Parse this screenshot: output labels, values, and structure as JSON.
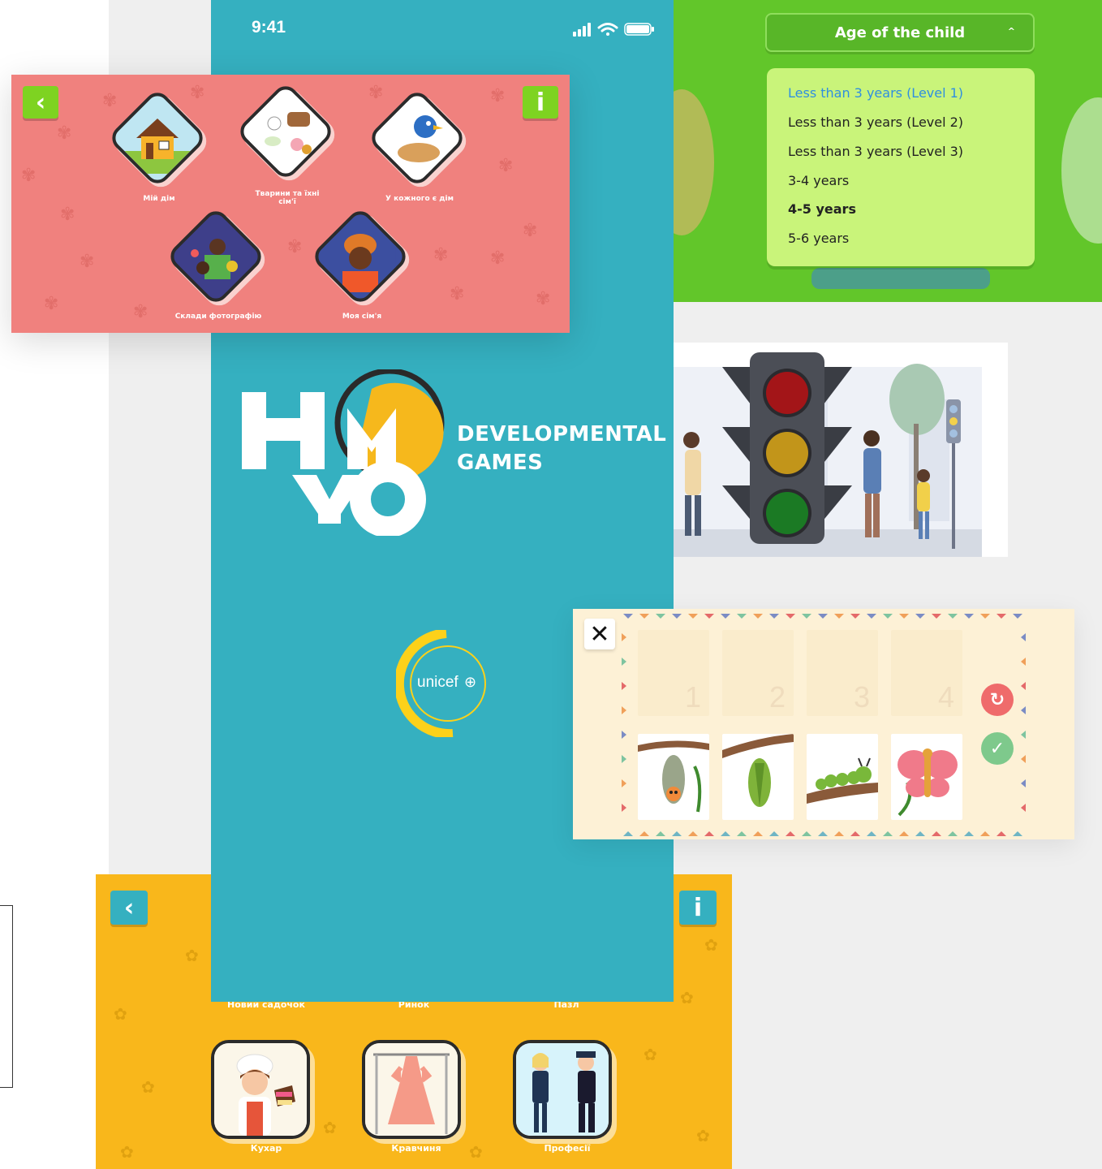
{
  "phone": {
    "status_time": "9:41",
    "brand_line1": "DEVELOPMENTAL",
    "brand_line2": "GAMES",
    "unicef": "unicef"
  },
  "pink_screen": {
    "back_icon": "‹",
    "info_icon": "i",
    "tiles": [
      {
        "label": "Мій дім"
      },
      {
        "label_line1": "Тварини та їхні",
        "label_line2": "сім'ї"
      },
      {
        "label": "У кожного є дім"
      },
      {
        "label": "Склади фотографію"
      },
      {
        "label": "Моя сім'я"
      }
    ]
  },
  "age_screen": {
    "header": "Age of the child",
    "chevron": "^",
    "options": [
      {
        "label": "Less than 3 years (Level 1)",
        "selected": true
      },
      {
        "label": "Less than 3 years (Level 2)"
      },
      {
        "label": "Less than 3 years (Level 3)"
      },
      {
        "label": "3-4 years"
      },
      {
        "label": "4-5 years"
      },
      {
        "label": "5-6 years"
      }
    ]
  },
  "sequence_screen": {
    "close_icon": "✕",
    "slots": [
      "1",
      "2",
      "3",
      "4"
    ],
    "cards": [
      "chrysalis-with-face",
      "green-chrysalis",
      "caterpillar",
      "butterfly"
    ],
    "reset_icon": "↻",
    "check_icon": "✓"
  },
  "yellow_screen": {
    "back_icon": "‹",
    "info_icon": "i",
    "top_labels": [
      "Новий садочок",
      "Ринок",
      "Пазл"
    ],
    "tiles": [
      {
        "label": "Кухар"
      },
      {
        "label": "Кравчиня"
      },
      {
        "label": "Професії"
      }
    ]
  },
  "colors": {
    "phone_bg": "#35b0c0",
    "pink_bg": "#f0817e",
    "green_bg": "#62c62a",
    "age_list_bg": "#c9f47a",
    "selected_option": "#2f8fe0",
    "yellow_bg": "#f9b71b",
    "button_green": "#7ed321",
    "button_teal": "#35b0c0",
    "unicef_yellow": "#fcd11a"
  }
}
